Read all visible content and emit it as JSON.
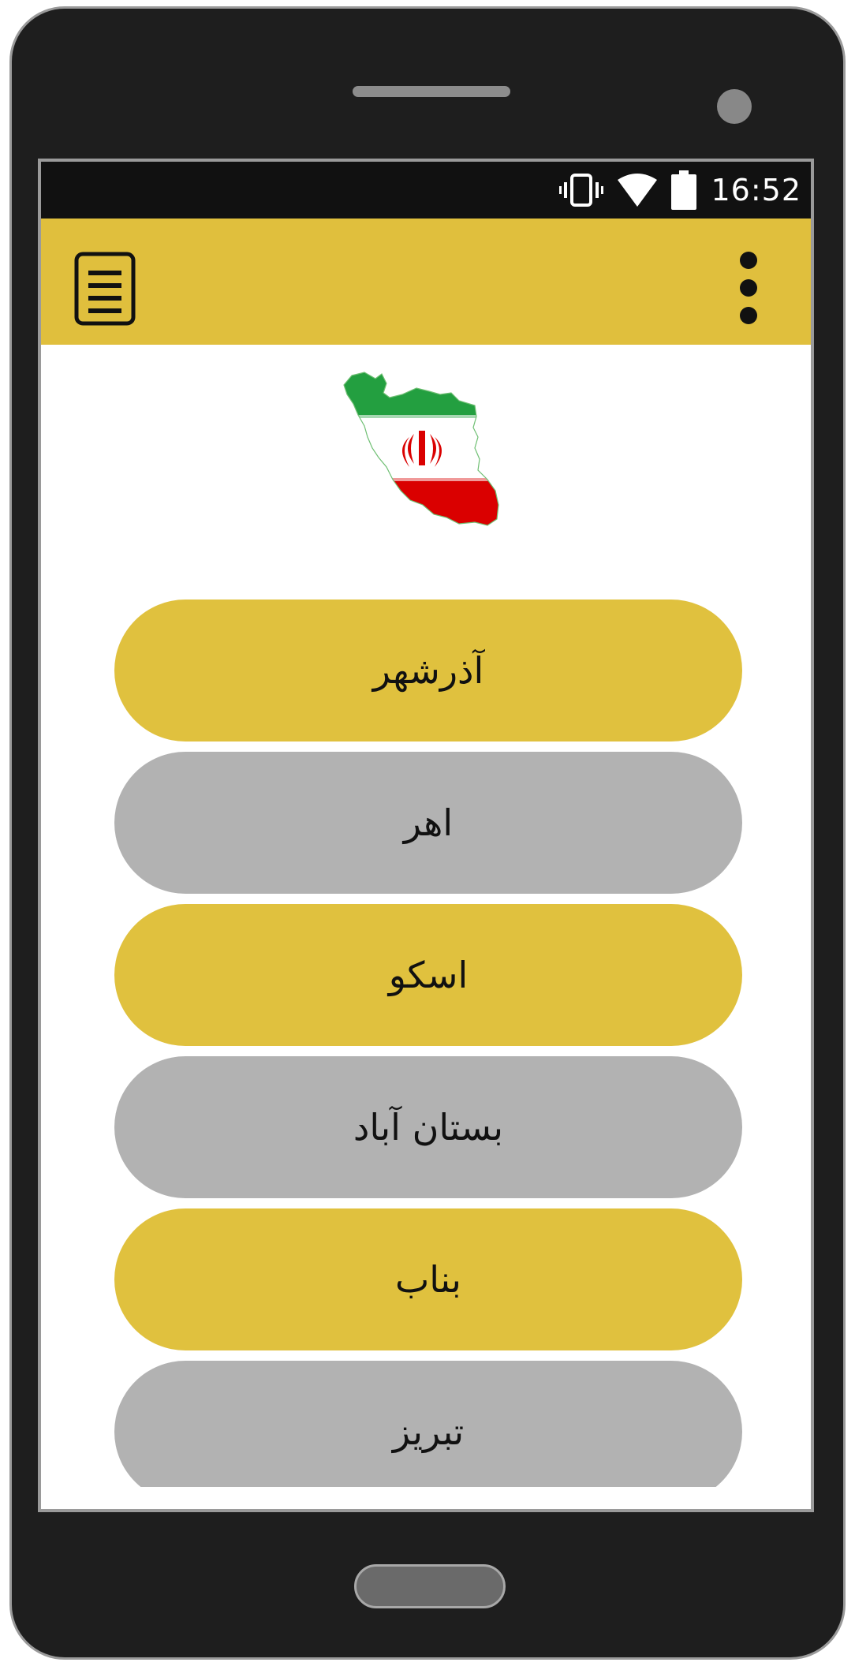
{
  "status_bar": {
    "time": "16:52",
    "icons": [
      "vibrate-icon",
      "wifi-icon",
      "battery-icon"
    ]
  },
  "app_bar": {
    "left_icon": "document-menu-icon",
    "right_icon": "overflow-menu-icon",
    "color": "#e0bf3d"
  },
  "header_image": "iran-flag-map",
  "cities": [
    {
      "label": "آذرشهر",
      "color": "yellow"
    },
    {
      "label": "اهر",
      "color": "gray"
    },
    {
      "label": "اسکو",
      "color": "yellow"
    },
    {
      "label": "بستان آباد",
      "color": "gray"
    },
    {
      "label": "بناب",
      "color": "yellow"
    },
    {
      "label": "تبریز",
      "color": "gray"
    }
  ],
  "colors": {
    "accent_yellow": "#e0c13e",
    "button_gray": "#b2b2b2",
    "status_bar": "#111111"
  }
}
